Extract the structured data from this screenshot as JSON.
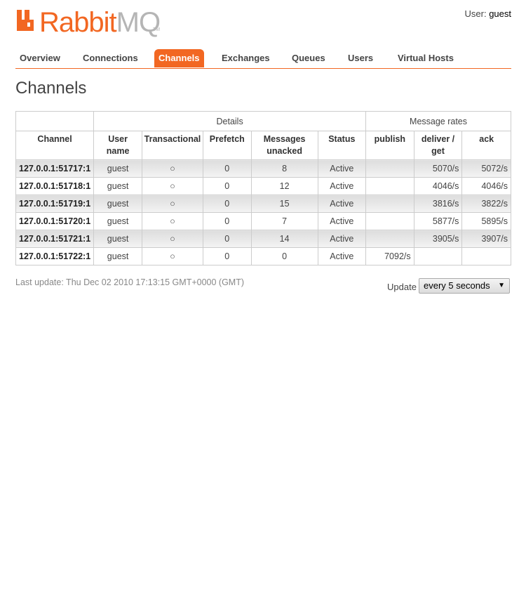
{
  "brand": {
    "logo_rabbit": "Rabbit",
    "logo_mq": "MQ",
    "logo_tm": "TM",
    "color_accent": "#f26722"
  },
  "user": {
    "label": "User:",
    "name": "guest"
  },
  "nav": {
    "tabs": [
      {
        "label": "Overview"
      },
      {
        "label": "Connections"
      },
      {
        "label": "Channels",
        "active": true
      },
      {
        "label": "Exchanges"
      },
      {
        "label": "Queues"
      },
      {
        "label": "Users"
      },
      {
        "label": "Virtual Hosts"
      }
    ]
  },
  "page": {
    "title": "Channels"
  },
  "table": {
    "groups": {
      "details": "Details",
      "message_rates": "Message rates"
    },
    "columns": {
      "channel": "Channel",
      "user_name": "User name",
      "transactional": "Transactional",
      "prefetch": "Prefetch",
      "messages_unacked": "Messages unacked",
      "status": "Status",
      "publish": "publish",
      "deliver_get": "deliver / get",
      "ack": "ack"
    },
    "rows": [
      {
        "channel": "127.0.0.1:51717:1",
        "user": "guest",
        "transactional": "○",
        "prefetch": "0",
        "unacked": "8",
        "status": "Active",
        "publish": "",
        "deliver": "5070/s",
        "ack": "5072/s"
      },
      {
        "channel": "127.0.0.1:51718:1",
        "user": "guest",
        "transactional": "○",
        "prefetch": "0",
        "unacked": "12",
        "status": "Active",
        "publish": "",
        "deliver": "4046/s",
        "ack": "4046/s"
      },
      {
        "channel": "127.0.0.1:51719:1",
        "user": "guest",
        "transactional": "○",
        "prefetch": "0",
        "unacked": "15",
        "status": "Active",
        "publish": "",
        "deliver": "3816/s",
        "ack": "3822/s"
      },
      {
        "channel": "127.0.0.1:51720:1",
        "user": "guest",
        "transactional": "○",
        "prefetch": "0",
        "unacked": "7",
        "status": "Active",
        "publish": "",
        "deliver": "5877/s",
        "ack": "5895/s"
      },
      {
        "channel": "127.0.0.1:51721:1",
        "user": "guest",
        "transactional": "○",
        "prefetch": "0",
        "unacked": "14",
        "status": "Active",
        "publish": "",
        "deliver": "3905/s",
        "ack": "3907/s"
      },
      {
        "channel": "127.0.0.1:51722:1",
        "user": "guest",
        "transactional": "○",
        "prefetch": "0",
        "unacked": "0",
        "status": "Active",
        "publish": "7092/s",
        "deliver": "",
        "ack": ""
      }
    ]
  },
  "footer": {
    "last_update": "Last update: Thu Dec 02 2010 17:13:15 GMT+0000 (GMT)",
    "update_label": "Update",
    "update_value": "every 5 seconds"
  }
}
